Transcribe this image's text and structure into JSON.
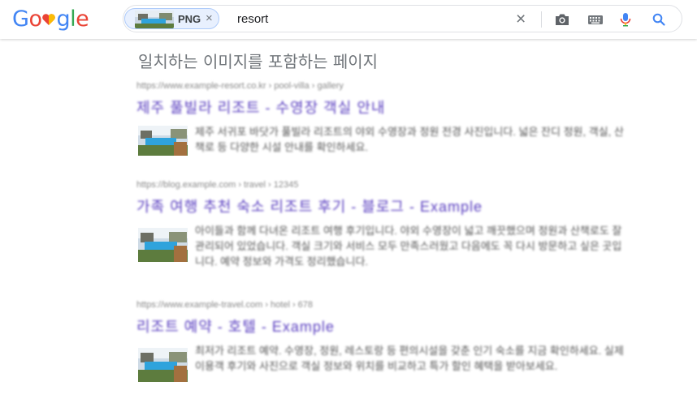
{
  "search": {
    "chip_label": "PNG",
    "chip_remove": "×",
    "query": "resort",
    "clear": "×"
  },
  "section_heading": "일치하는 이미지를 포함하는 페이지",
  "results": [
    {
      "url": "https://www.example-resort.co.kr › pool-villa › gallery",
      "title": "제주 풀빌라 리조트 - 수영장 객실 안내",
      "snippet": "제주 서귀포 바닷가 풀빌라 리조트의 야외 수영장과 정원 전경 사진입니다. 넓은 잔디 정원, 객실, 산책로 등 다양한 시설 안내를 확인하세요."
    },
    {
      "url": "https://blog.example.com › travel › 12345",
      "title": "가족 여행 추천 숙소 리조트 후기 - 블로그 - Example",
      "snippet": "아이들과 함께 다녀온 리조트 여행 후기입니다. 야외 수영장이 넓고 깨끗했으며 정원과 산책로도 잘 관리되어 있었습니다. 객실 크기와 서비스 모두 만족스러웠고 다음에도 꼭 다시 방문하고 싶은 곳입니다. 예약 정보와 가격도 정리했습니다."
    },
    {
      "url": "https://www.example-travel.com › hotel › 678",
      "title": "리조트 예약 - 호텔 - Example",
      "snippet": "최저가 리조트 예약. 수영장, 정원, 레스토랑 등 편의시설을 갖춘 인기 숙소를 지금 확인하세요. 실제 이용객 후기와 사진으로 객실 정보와 위치를 비교하고 특가 할인 혜택을 받아보세요."
    }
  ],
  "colors": {
    "accent_blue": "#4285f4",
    "chip_bg": "#e8f0fe",
    "mic_red": "#ea4335",
    "heading_gray": "#70757a"
  },
  "icons": [
    "google-logo",
    "camera-icon",
    "keyboard-icon",
    "mic-icon",
    "search-icon",
    "close-icon"
  ]
}
